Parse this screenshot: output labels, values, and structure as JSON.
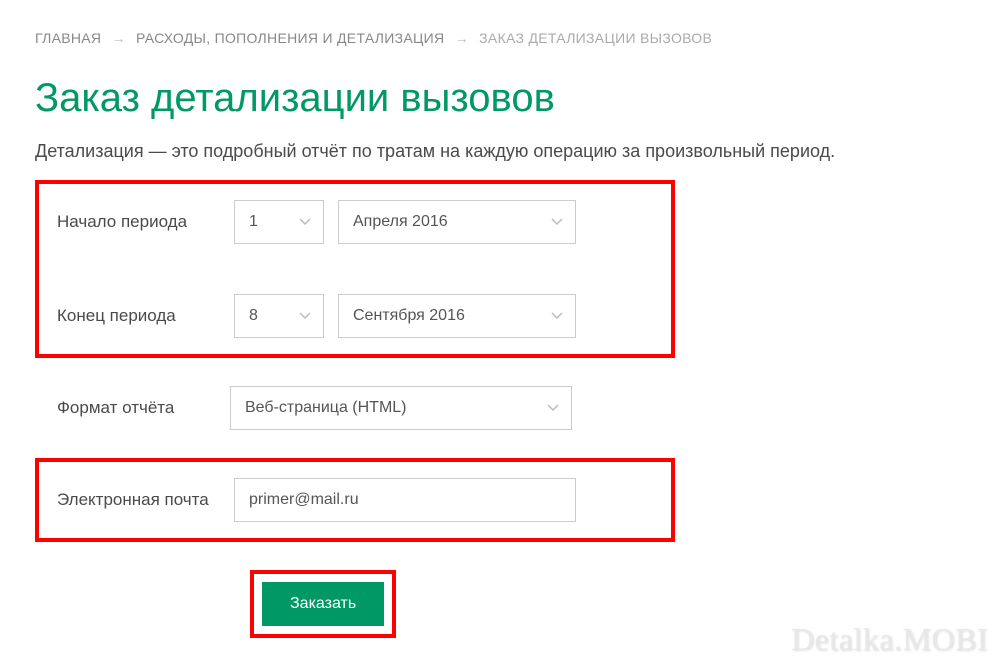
{
  "breadcrumb": {
    "home": "ГЛАВНАЯ",
    "middle": "РАСХОДЫ, ПОПОЛНЕНИЯ И ДЕТАЛИЗАЦИЯ",
    "current": "ЗАКАЗ ДЕТАЛИЗАЦИИ ВЫЗОВОВ"
  },
  "page": {
    "title": "Заказ детализации вызовов",
    "description": "Детализация — это подробный отчёт по тратам на каждую операцию за произвольный период."
  },
  "form": {
    "period_start": {
      "label": "Начало периода",
      "day": "1",
      "month": "Апреля 2016"
    },
    "period_end": {
      "label": "Конец периода",
      "day": "8",
      "month": "Сентября 2016"
    },
    "format": {
      "label": "Формат отчёта",
      "value": "Веб-страница (HTML)"
    },
    "email": {
      "label": "Электронная почта",
      "value": "primer@mail.ru"
    },
    "submit": "Заказать"
  },
  "watermark": "Detalka.MOBI"
}
